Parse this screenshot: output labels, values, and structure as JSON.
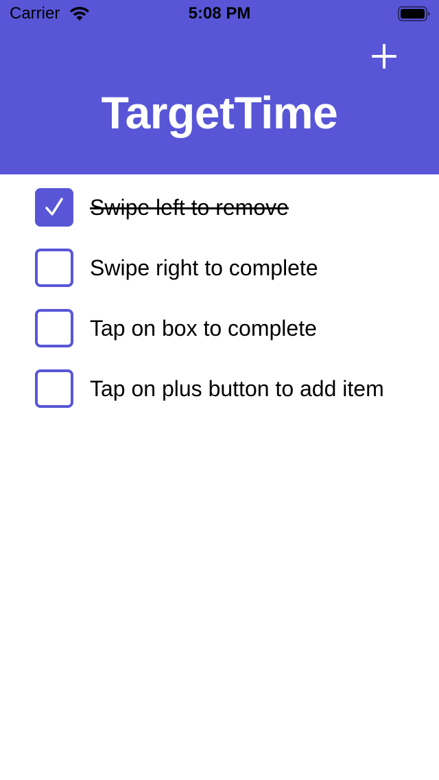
{
  "status_bar": {
    "carrier": "Carrier",
    "time": "5:08 PM",
    "wifi_icon": "wifi-icon",
    "battery_icon": "battery-icon"
  },
  "header": {
    "title": "TargetTime",
    "add_icon": "plus-icon",
    "background_color": "#5856d6"
  },
  "todo_items": [
    {
      "label": "Swipe left to remove",
      "completed": true
    },
    {
      "label": "Swipe right to complete",
      "completed": false
    },
    {
      "label": "Tap on box to complete",
      "completed": false
    },
    {
      "label": "Tap on plus button to add item",
      "completed": false
    }
  ],
  "colors": {
    "accent": "#5856d6",
    "text": "#000000",
    "background": "#ffffff"
  }
}
